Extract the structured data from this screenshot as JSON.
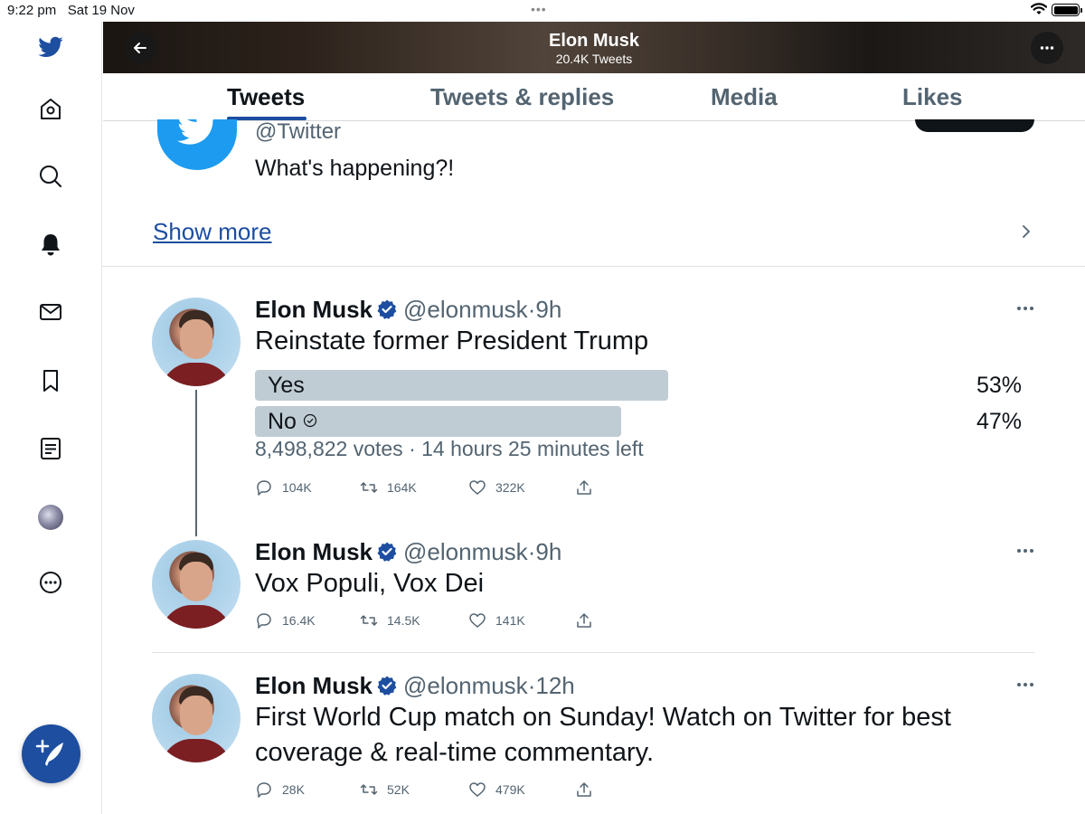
{
  "status_bar": {
    "time": "9:22 pm",
    "date": "Sat 19 Nov",
    "dots": "•••"
  },
  "header": {
    "title": "Elon Musk",
    "subtitle": "20.4K Tweets"
  },
  "tabs": [
    {
      "label": "Tweets",
      "active": true
    },
    {
      "label": "Tweets & replies",
      "active": false
    },
    {
      "label": "Media",
      "active": false
    },
    {
      "label": "Likes",
      "active": false
    }
  ],
  "sidebar": {
    "icons": [
      "twitter-logo-icon",
      "home-icon",
      "search-icon",
      "notifications-icon",
      "messages-icon",
      "bookmarks-icon",
      "lists-icon",
      "profile-avatar",
      "more-icon",
      "compose-tweet-icon"
    ]
  },
  "top_card": {
    "handle": "@Twitter",
    "bio": "What's happening?!",
    "show_more": "Show more"
  },
  "tweets": [
    {
      "name": "Elon Musk",
      "handle": "@elonmusk",
      "sep": "·",
      "time": "9h",
      "text": "Reinstate former President Trump",
      "poll": {
        "options": [
          {
            "label": "Yes",
            "percent_label": "53%",
            "percent": 53,
            "selected": false
          },
          {
            "label": "No",
            "percent_label": "47%",
            "percent": 47,
            "selected": true
          }
        ],
        "info": "8,498,822 votes · 14 hours 25 minutes left"
      },
      "replies": "104K",
      "retweets": "164K",
      "likes": "322K"
    },
    {
      "name": "Elon Musk",
      "handle": "@elonmusk",
      "sep": "·",
      "time": "9h",
      "text": "Vox Populi, Vox Dei",
      "replies": "16.4K",
      "retweets": "14.5K",
      "likes": "141K"
    },
    {
      "name": "Elon Musk",
      "handle": "@elonmusk",
      "sep": "·",
      "time": "12h",
      "text": "First World Cup match on Sunday! Watch on Twitter for best coverage & real-time commentary.",
      "replies": "28K",
      "retweets": "52K",
      "likes": "479K"
    }
  ],
  "colors": {
    "accent": "#1d4ea0",
    "twitter_blue": "#1d9bf0",
    "muted": "#536471",
    "poll_bar": "#c0ccd3"
  }
}
